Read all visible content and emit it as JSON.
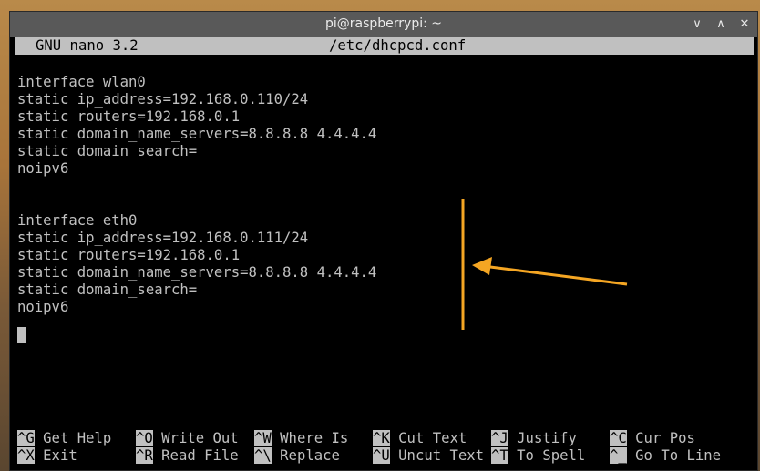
{
  "window": {
    "title": "pi@raspberrypi: ~",
    "controls": {
      "minimize": "∨",
      "maximize": "∧",
      "close": "✕"
    }
  },
  "nano": {
    "version": "GNU nano 3.2",
    "filename": "/etc/dhcpcd.conf"
  },
  "lines": [
    "",
    "interface wlan0",
    "static ip_address=192.168.0.110/24",
    "static routers=192.168.0.1",
    "static domain_name_servers=8.8.8.8 4.4.4.4",
    "static domain_search=",
    "noipv6",
    "",
    "",
    "interface eth0",
    "static ip_address=192.168.0.111/24",
    "static routers=192.168.0.1",
    "static domain_name_servers=8.8.8.8 4.4.4.4",
    "static domain_search=",
    "noipv6"
  ],
  "shortcuts": [
    [
      {
        "key": "^G",
        "label": "Get Help"
      },
      {
        "key": "^O",
        "label": "Write Out"
      },
      {
        "key": "^W",
        "label": "Where Is"
      },
      {
        "key": "^K",
        "label": "Cut Text"
      },
      {
        "key": "^J",
        "label": "Justify"
      },
      {
        "key": "^C",
        "label": "Cur Pos"
      }
    ],
    [
      {
        "key": "^X",
        "label": "Exit"
      },
      {
        "key": "^R",
        "label": "Read File"
      },
      {
        "key": "^\\",
        "label": "Replace"
      },
      {
        "key": "^U",
        "label": "Uncut Text"
      },
      {
        "key": "^T",
        "label": "To Spell"
      },
      {
        "key": "^_",
        "label": "Go To Line"
      }
    ]
  ],
  "colors": {
    "terminal_bg": "#000000",
    "terminal_fg": "#c0c0c0",
    "annotation": "#f5a623"
  }
}
